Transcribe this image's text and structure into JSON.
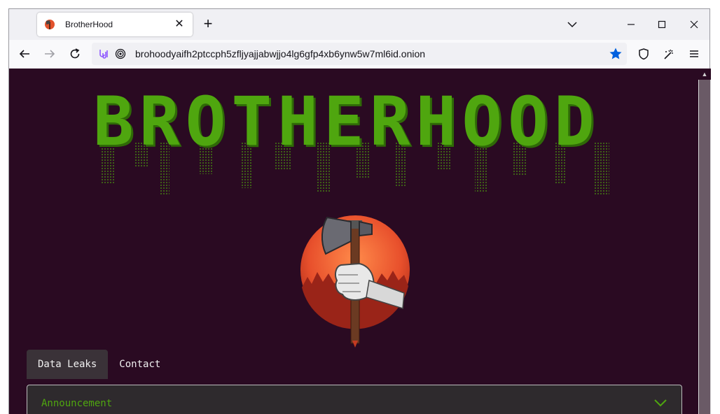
{
  "browser": {
    "tab": {
      "title": "BrotherHood",
      "favicon": "brotherhood-favicon"
    },
    "url": "brohoodyaifh2ptccph5zfljyajjabwjjo4lg6gfp4xb6ynw5w7ml6id.onion",
    "icons": [
      "back-icon",
      "forward-icon",
      "reload-icon",
      "onion-circuit-icon",
      "tracking-protection-icon",
      "bookmark-star-icon",
      "shield-icon",
      "new-identity-icon",
      "menu-icon"
    ],
    "accent": "#0060df"
  },
  "page": {
    "logo_text": "BROTHERHOOD",
    "logo_color": "#4fa60f",
    "background": "#2a0a22",
    "tabs": [
      {
        "label": "Data Leaks",
        "active": true
      },
      {
        "label": "Contact",
        "active": false
      }
    ],
    "accordion": {
      "title": "Announcement"
    }
  }
}
